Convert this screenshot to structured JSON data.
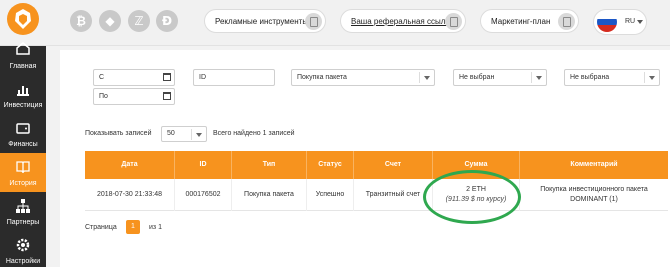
{
  "header": {
    "logo_icon": "lion-logo-icon",
    "coins": [
      {
        "name": "bitcoin-icon",
        "glyph": "₿"
      },
      {
        "name": "ethereum-icon",
        "glyph": "◆"
      },
      {
        "name": "zcash-icon",
        "glyph": "ℤ"
      },
      {
        "name": "dash-icon",
        "glyph": "Ð"
      }
    ],
    "promo_tools": "Рекламные инструменты",
    "referral_link": "Ваша реферальная ссылка",
    "marketing_plan": "Маркетинг-план",
    "language": "RU"
  },
  "sidebar": {
    "items": [
      {
        "label": "Главная",
        "icon": "home-icon"
      },
      {
        "label": "Инвестиция",
        "icon": "bar-chart-icon"
      },
      {
        "label": "Финансы",
        "icon": "wallet-icon"
      },
      {
        "label": "История",
        "icon": "book-icon",
        "active": true
      },
      {
        "label": "Партнеры",
        "icon": "network-icon"
      },
      {
        "label": "Настройки",
        "icon": "gear-icon"
      }
    ]
  },
  "filters": {
    "date_from": "С",
    "date_to": "По",
    "id_placeholder": "ID",
    "type_select": "Покупка пакета",
    "status_select": "Не выбран",
    "account_select": "Не выбрана"
  },
  "records": {
    "show_label": "Показывать записей",
    "per_page": "50",
    "found_text": "Всего найдено 1 записей"
  },
  "table": {
    "headers": [
      "Дата",
      "ID",
      "Тип",
      "Статус",
      "Счет",
      "Сумма",
      "Комментарий"
    ],
    "row": {
      "date": "2018-07-30 21:33:48",
      "id": "000176502",
      "type": "Покупка пакета",
      "status": "Успешно",
      "account": "Транзитный счет",
      "amount": "2 ETH",
      "amount_usd": "(911.39 $ по курсу)",
      "comment_line1": "Покупка инвестиционного пакета",
      "comment_line2": "DOMINANT (1)"
    }
  },
  "pager": {
    "label": "Страница",
    "current": "1",
    "of": "из 1"
  },
  "colors": {
    "accent": "#f7931e",
    "sidebar": "#2b2b2b",
    "highlight": "#2fa84f"
  }
}
